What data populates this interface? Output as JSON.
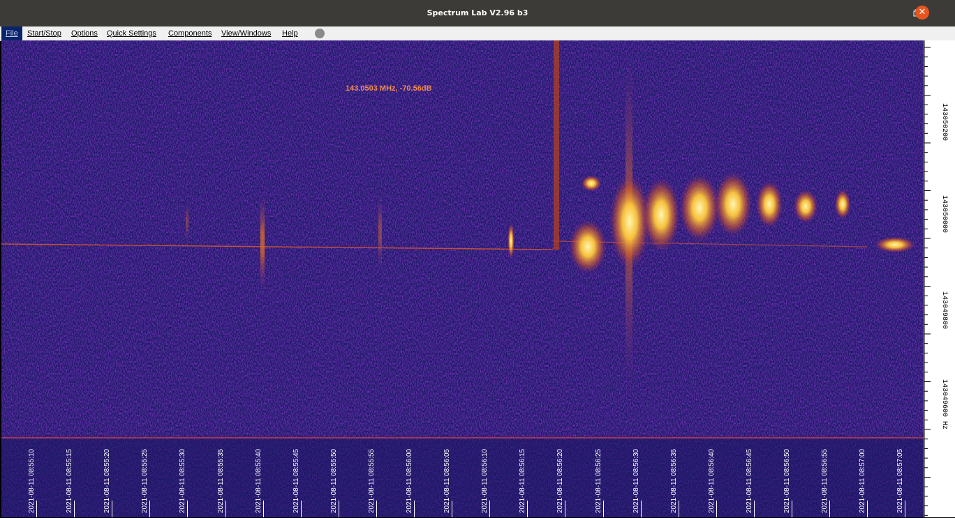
{
  "window": {
    "title": "Spectrum Lab V2.96 b3"
  },
  "menu": [
    {
      "label": "File"
    },
    {
      "label": "Start/Stop"
    },
    {
      "label": "Options"
    },
    {
      "label": "Quick Settings"
    },
    {
      "label": "Components"
    },
    {
      "label": "View/Windows"
    },
    {
      "label": "Help"
    }
  ],
  "readout": "143.0503 MHz, -70.56dB",
  "frequency_axis": {
    "labels": [
      "143050200",
      "143050000",
      "143049800",
      "143049600 Hz"
    ]
  },
  "time_labels": [
    "2021-08-11 08:55:10",
    "2021-08-11 08:55:15",
    "2021-08-11 08:55:20",
    "2021-08-11 08:55:25",
    "2021-08-11 08:55:30",
    "2021-08-11 08:55:35",
    "2021-08-11 08:55:40",
    "2021-08-11 08:55:45",
    "2021-08-11 08:55:50",
    "2021-08-11 08:55:55",
    "2021-08-11 08:56:00",
    "2021-08-11 08:56:05",
    "2021-08-11 08:56:10",
    "2021-08-11 08:56:15",
    "2021-08-11 08:56:20",
    "2021-08-11 08:56:25",
    "2021-08-11 08:56:30",
    "2021-08-11 08:56:35",
    "2021-08-11 08:56:40",
    "2021-08-11 08:56:45",
    "2021-08-11 08:56:50",
    "2021-08-11 08:56:55",
    "2021-08-11 08:57:00",
    "2021-08-11 08:57:05"
  ],
  "colors": {
    "background": "#1e1a6e",
    "hot": "#ffd23a",
    "carrier": "#ff6a2a"
  }
}
